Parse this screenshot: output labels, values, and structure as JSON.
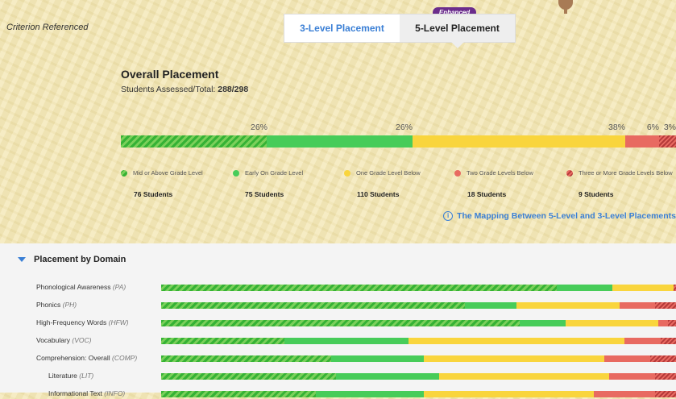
{
  "header": {
    "criterion_label": "Criterion Referenced",
    "tabs": [
      {
        "label": "3-Level Placement",
        "active": false
      },
      {
        "label": "5-Level Placement",
        "active": true
      }
    ],
    "enhanced_badge": "Enhanced"
  },
  "overall": {
    "title": "Overall Placement",
    "assessed_label": "Students Assessed/Total:",
    "assessed_value": "288/298",
    "percent_labels": [
      "26%",
      "26%",
      "38%",
      "6%",
      "3%"
    ],
    "segments": [
      26,
      26,
      38,
      6,
      3
    ],
    "legend": [
      {
        "label": "Mid or Above Grade Level",
        "count": "76 Students",
        "color": "#35b235"
      },
      {
        "label": "Early On Grade Level",
        "count": "75 Students",
        "color": "#47cc59"
      },
      {
        "label": "One Grade Level Below",
        "count": "110 Students",
        "color": "#f9d53d"
      },
      {
        "label": "Two Grade Levels Below",
        "count": "18 Students",
        "color": "#e86a61"
      },
      {
        "label": "Three or More Grade Levels Below",
        "count": "9 Students",
        "color": "#b53a3a"
      }
    ],
    "mapping_link": "The Mapping Between 5-Level and 3-Level Placements"
  },
  "domains": {
    "title": "Placement by Domain",
    "rows": [
      {
        "name": "Phonological Awareness",
        "abbr": "(PA)",
        "indent": false,
        "segments": [
          78,
          11,
          12,
          0,
          0.5
        ]
      },
      {
        "name": "Phonics",
        "abbr": "(PH)",
        "indent": false,
        "segments": [
          59,
          10,
          20,
          7,
          4
        ]
      },
      {
        "name": "High-Frequency Words",
        "abbr": "(HFW)",
        "indent": false,
        "segments": [
          70,
          9,
          18,
          2,
          1.5
        ]
      },
      {
        "name": "Vocabulary",
        "abbr": "(VOC)",
        "indent": false,
        "segments": [
          24,
          24,
          42,
          7,
          3
        ]
      },
      {
        "name": "Comprehension: Overall",
        "abbr": "(COMP)",
        "indent": false,
        "segments": [
          33,
          18,
          35,
          9,
          5
        ]
      },
      {
        "name": "Literature",
        "abbr": "(LIT)",
        "indent": true,
        "segments": [
          34,
          20,
          33,
          9,
          4
        ]
      },
      {
        "name": "Informational Text",
        "abbr": "(INFO)",
        "indent": true,
        "segments": [
          30,
          21,
          33,
          12,
          4
        ]
      }
    ]
  }
}
